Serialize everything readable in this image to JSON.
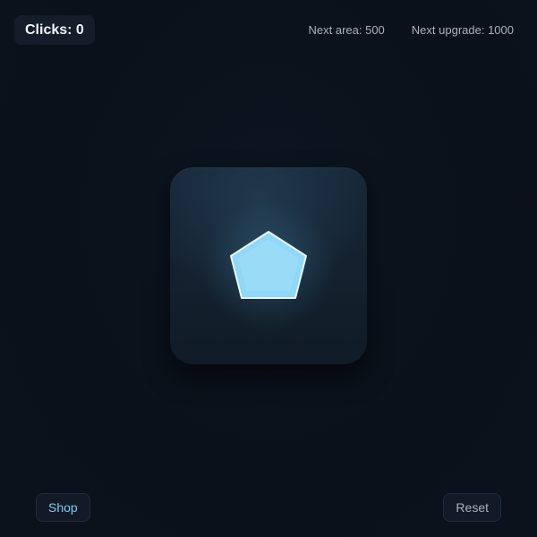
{
  "hud": {
    "clicks_label": "Clicks: 0",
    "next_area": "Next area: 500",
    "next_upgrade": "Next upgrade: 1000"
  },
  "clicker": {
    "icon": "pentagon-icon",
    "fill_color": "#8fd8f7",
    "stroke_color": "#e8f7ff"
  },
  "actions": {
    "shop_label": "Shop",
    "reset_label": "Reset"
  }
}
